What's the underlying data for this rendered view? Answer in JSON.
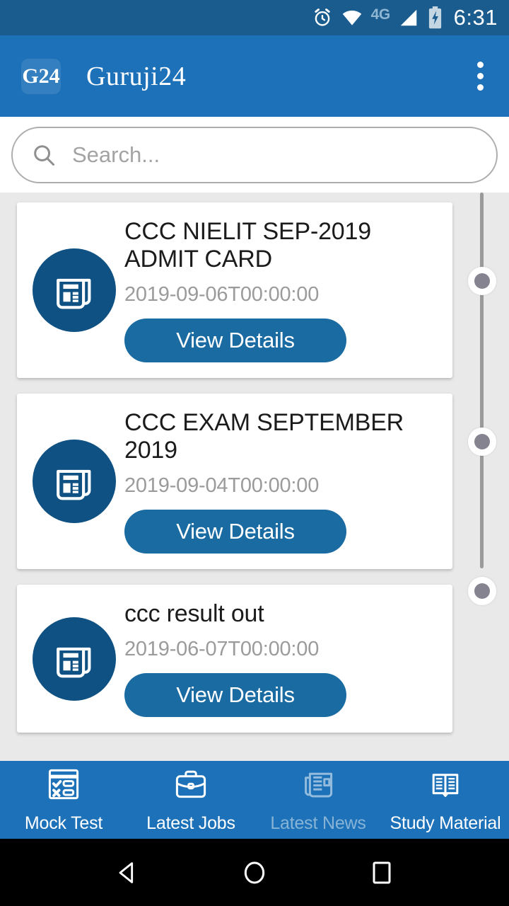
{
  "status_bar": {
    "icons": [
      "alarm-icon",
      "wifi-icon",
      "signal-icon",
      "battery-charging-icon"
    ],
    "network_label": "4G",
    "time": "6:31",
    "background_color": "#1a5c8e"
  },
  "app_bar": {
    "logo_text": "G24",
    "title": "Guruji24",
    "overflow_label": "More options",
    "background_color": "#1d71b8"
  },
  "search": {
    "placeholder": "Search...",
    "value": "",
    "icon": "search-icon"
  },
  "news_list": {
    "items": [
      {
        "icon": "newspaper-icon",
        "title": "CCC NIELIT SEP-2019 ADMIT CARD",
        "date": "2019-09-06T00:00:00",
        "button_label": "View Details"
      },
      {
        "icon": "newspaper-icon",
        "title": "CCC EXAM SEPTEMBER 2019",
        "date": "2019-09-04T00:00:00",
        "button_label": "View Details"
      },
      {
        "icon": "newspaper-icon",
        "title": "ccc result out",
        "date": "2019-06-07T00:00:00",
        "button_label": "View Details"
      }
    ],
    "card_background": "#ffffff",
    "accent_color": "#1b6ba3",
    "icon_circle_color": "#0f5182",
    "page_background": "#e9e9e9"
  },
  "timeline": {
    "dot_count": 3,
    "line_color": "#9a9a9a",
    "dot_color": "#84838f"
  },
  "bottom_nav": {
    "items": [
      {
        "label": "Mock Test",
        "icon": "mock-test-icon",
        "active": false
      },
      {
        "label": "Latest Jobs",
        "icon": "briefcase-icon",
        "active": false
      },
      {
        "label": "Latest News",
        "icon": "newspaper-outline-icon",
        "active": true
      },
      {
        "label": "Study Material",
        "icon": "open-book-icon",
        "active": false
      }
    ],
    "background_color": "#1d71b8"
  },
  "android_nav": {
    "back_label": "Back",
    "home_label": "Home",
    "recents_label": "Recent apps",
    "background_color": "#000000"
  }
}
